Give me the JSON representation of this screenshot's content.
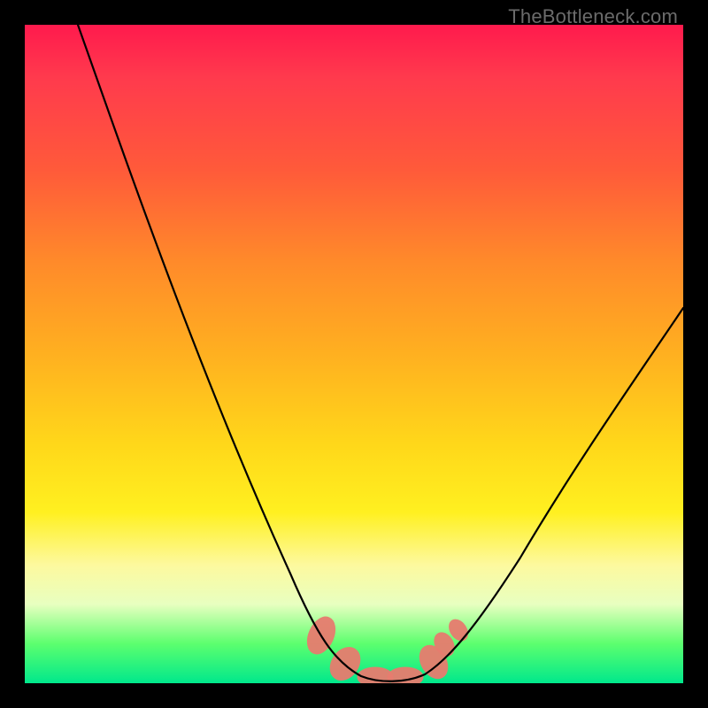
{
  "watermark": "TheBottleneck.com",
  "chart_data": {
    "type": "line",
    "title": "",
    "xlabel": "",
    "ylabel": "",
    "xlim": [
      0,
      100
    ],
    "ylim": [
      0,
      100
    ],
    "grid": false,
    "legend": false,
    "background_gradient": {
      "direction": "vertical",
      "stops": [
        {
          "pos": 0,
          "color": "#ff1a4d"
        },
        {
          "pos": 50,
          "color": "#ffd81a"
        },
        {
          "pos": 88,
          "color": "#e8ffc0"
        },
        {
          "pos": 100,
          "color": "#00e88c"
        }
      ]
    },
    "series": [
      {
        "name": "bottleneck-curve",
        "x": [
          8,
          20,
          30,
          40,
          45,
          48,
          52,
          56,
          60,
          65,
          75,
          90,
          100
        ],
        "y": [
          100,
          70,
          45,
          20,
          8,
          2,
          0,
          0,
          2,
          6,
          18,
          40,
          58
        ],
        "stroke": "#000000"
      }
    ],
    "markers": {
      "note": "salmon blobs near curve minimum",
      "approx_x_range": [
        44,
        63
      ],
      "approx_y_range": [
        0,
        10
      ],
      "color": "#e77c6f"
    }
  }
}
